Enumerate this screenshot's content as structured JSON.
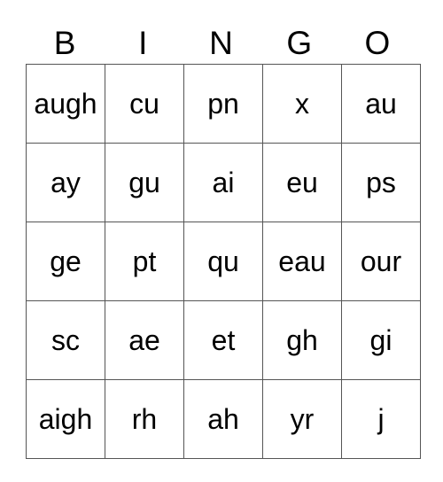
{
  "card": {
    "headers": [
      "B",
      "I",
      "N",
      "G",
      "O"
    ],
    "rows": [
      [
        "augh",
        "cu",
        "pn",
        "x",
        "au"
      ],
      [
        "ay",
        "gu",
        "ai",
        "eu",
        "ps"
      ],
      [
        "ge",
        "pt",
        "qu",
        "eau",
        "our"
      ],
      [
        "sc",
        "ae",
        "et",
        "gh",
        "gi"
      ],
      [
        "aigh",
        "rh",
        "ah",
        "yr",
        "j"
      ]
    ],
    "colors": {
      "background": "#ffffff",
      "text": "#000000",
      "border": "#555555"
    }
  }
}
